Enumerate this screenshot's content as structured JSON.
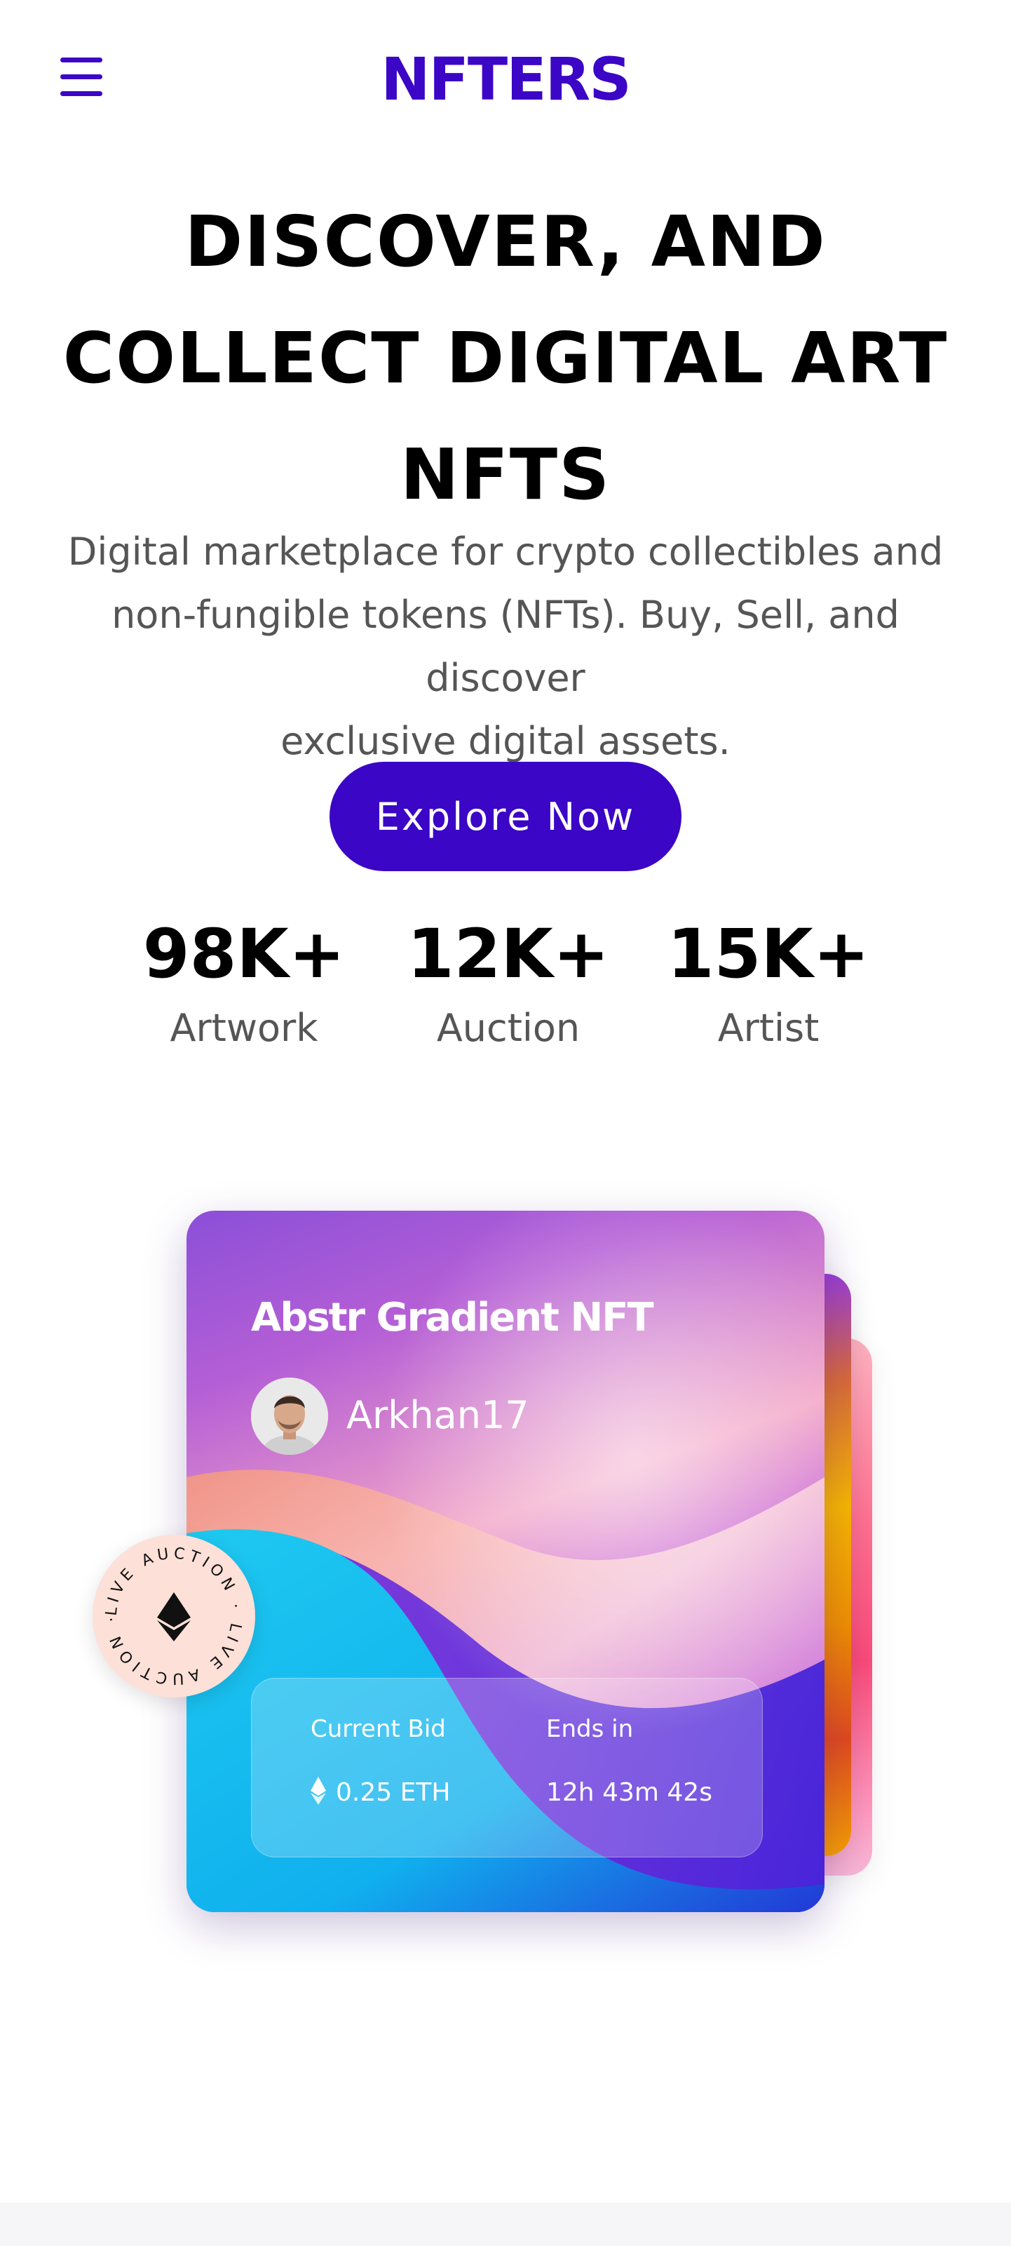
{
  "header": {
    "logo": "NFTERS",
    "menu_icon": "hamburger-menu-icon"
  },
  "hero": {
    "title_line1": "DISCOVER, AND",
    "title_line2": "COLLECT DIGITAL ART",
    "title_line3": "NFTS",
    "subtitle_line1": "Digital marketplace for crypto collectibles and",
    "subtitle_line2": "non-fungible tokens (NFTs). Buy, Sell, and discover",
    "subtitle_line3": "exclusive digital assets.",
    "cta_label": "Explore Now"
  },
  "stats": [
    {
      "value": "98K+",
      "label": "Artwork"
    },
    {
      "value": "12K+",
      "label": "Auction"
    },
    {
      "value": "15K+",
      "label": "Artist"
    }
  ],
  "featured_card": {
    "title": "Abstr Gradient NFT",
    "artist": "Arkhan17",
    "current_bid_label": "Current Bid",
    "current_bid_value": "0.25 ETH",
    "ends_in_label": "Ends in",
    "ends_in_value": "12h 43m 42s",
    "badge_text": "LIVE AUCTION · LIVE AUCTION ·",
    "badge_icon": "ethereum-icon"
  },
  "colors": {
    "brand": "#3b06c6",
    "text_dark": "#000000",
    "text_muted": "#555555",
    "badge_bg": "#fde0d8"
  }
}
